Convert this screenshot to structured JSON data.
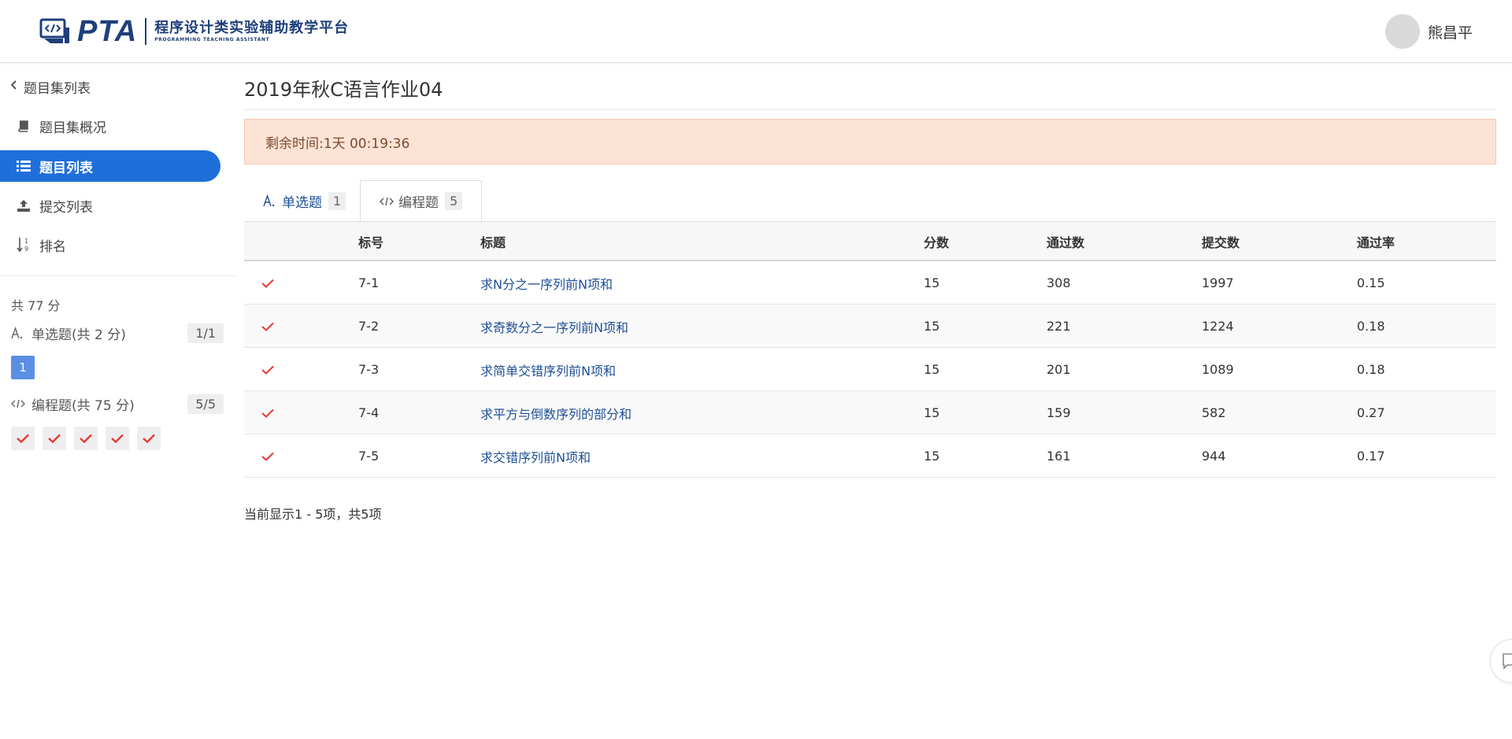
{
  "header": {
    "logo_text": "PTA",
    "logo_cn": "程序设计类实验辅助教学平台",
    "logo_en": "PROGRAMMING TEACHING ASSISTANT",
    "user_name": "熊昌平"
  },
  "sidebar": {
    "back_label": "题目集列表",
    "items": [
      {
        "label": "题目集概况",
        "icon": "book-icon",
        "active": false
      },
      {
        "label": "题目列表",
        "icon": "list-icon",
        "active": true
      },
      {
        "label": "提交列表",
        "icon": "upload-icon",
        "active": false
      },
      {
        "label": "排名",
        "icon": "sort-numeric-icon",
        "active": false
      }
    ],
    "total_score": "共 77 分",
    "sections": [
      {
        "title": "单选题(共 2 分)",
        "icon": "choice-icon",
        "count": "1/1",
        "boxes": [
          "1"
        ]
      },
      {
        "title": "编程题(共 75 分)",
        "icon": "code-icon",
        "count": "5/5",
        "boxes": [
          "check",
          "check",
          "check",
          "check",
          "check"
        ]
      }
    ]
  },
  "main": {
    "title": "2019年秋C语言作业04",
    "remaining_time": "剩余时间:1天 00:19:36",
    "tabs": [
      {
        "label": "单选题",
        "count": "1",
        "icon": "choice-icon",
        "active": false
      },
      {
        "label": "编程题",
        "count": "5",
        "icon": "code-icon",
        "active": true
      }
    ],
    "table": {
      "headers": [
        "标号",
        "标题",
        "分数",
        "通过数",
        "提交数",
        "通过率"
      ],
      "rows": [
        {
          "id": "7-1",
          "title": "求N分之一序列前N项和",
          "score": "15",
          "passed": "308",
          "submitted": "1997",
          "rate": "0.15"
        },
        {
          "id": "7-2",
          "title": "求奇数分之一序列前N项和",
          "score": "15",
          "passed": "221",
          "submitted": "1224",
          "rate": "0.18"
        },
        {
          "id": "7-3",
          "title": "求简单交错序列前N项和",
          "score": "15",
          "passed": "201",
          "submitted": "1089",
          "rate": "0.18"
        },
        {
          "id": "7-4",
          "title": "求平方与倒数序列的部分和",
          "score": "15",
          "passed": "159",
          "submitted": "582",
          "rate": "0.27"
        },
        {
          "id": "7-5",
          "title": "求交错序列前N项和",
          "score": "15",
          "passed": "161",
          "submitted": "944",
          "rate": "0.17"
        }
      ]
    },
    "footer_info": "当前显示1 - 5项，共5项"
  },
  "colors": {
    "brand": "#1e3f7a",
    "accent": "#1e6fd9",
    "link": "#1e4f96",
    "check": "#e53935",
    "alert_bg": "#fde3d6"
  }
}
